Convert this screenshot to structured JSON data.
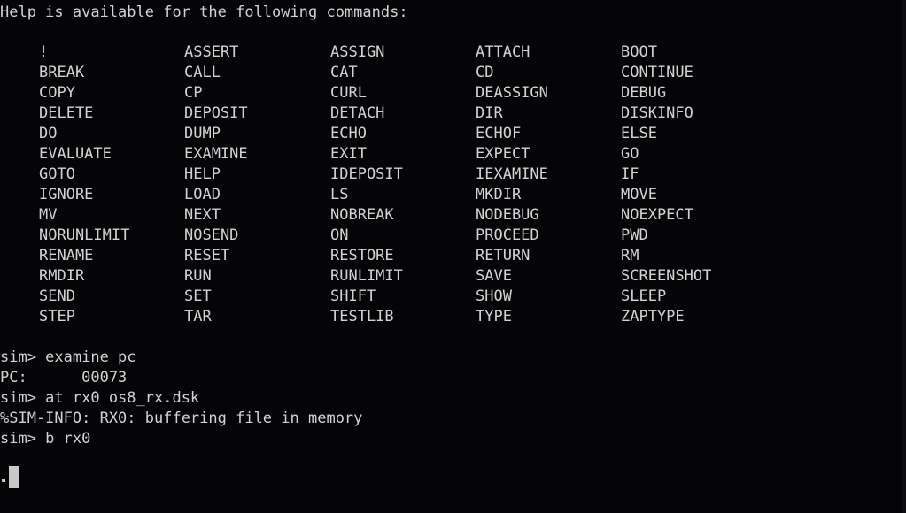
{
  "terminal": {
    "background_color": "#050508",
    "foreground_color": "#d2d2d2",
    "cursor_color": "#c9c9c9",
    "help_header": "Help is available for the following commands:",
    "columns": 5,
    "command_rows": [
      [
        "!",
        "ASSERT",
        "ASSIGN",
        "ATTACH",
        "BOOT"
      ],
      [
        "BREAK",
        "CALL",
        "CAT",
        "CD",
        "CONTINUE"
      ],
      [
        "COPY",
        "CP",
        "CURL",
        "DEASSIGN",
        "DEBUG"
      ],
      [
        "DELETE",
        "DEPOSIT",
        "DETACH",
        "DIR",
        "DISKINFO"
      ],
      [
        "DO",
        "DUMP",
        "ECHO",
        "ECHOF",
        "ELSE"
      ],
      [
        "EVALUATE",
        "EXAMINE",
        "EXIT",
        "EXPECT",
        "GO"
      ],
      [
        "GOTO",
        "HELP",
        "IDEPOSIT",
        "IEXAMINE",
        "IF"
      ],
      [
        "IGNORE",
        "LOAD",
        "LS",
        "MKDIR",
        "MOVE"
      ],
      [
        "MV",
        "NEXT",
        "NOBREAK",
        "NODEBUG",
        "NOEXPECT"
      ],
      [
        "NORUNLIMIT",
        "NOSEND",
        "ON",
        "PROCEED",
        "PWD"
      ],
      [
        "RENAME",
        "RESET",
        "RESTORE",
        "RETURN",
        "RM"
      ],
      [
        "RMDIR",
        "RUN",
        "RUNLIMIT",
        "SAVE",
        "SCREENSHOT"
      ],
      [
        "SEND",
        "SET",
        "SHIFT",
        "SHOW",
        "SLEEP"
      ],
      [
        "STEP",
        "TAR",
        "TESTLIB",
        "TYPE",
        "ZAPTYPE"
      ]
    ],
    "session_lines": [
      "sim> examine pc",
      "PC:      00073",
      "sim> at rx0 os8_rx.dsk",
      "%SIM-INFO: RX0: buffering file in memory",
      "sim> b rx0"
    ],
    "prompt": "sim>",
    "cursor_glyph": "block-cursor"
  }
}
